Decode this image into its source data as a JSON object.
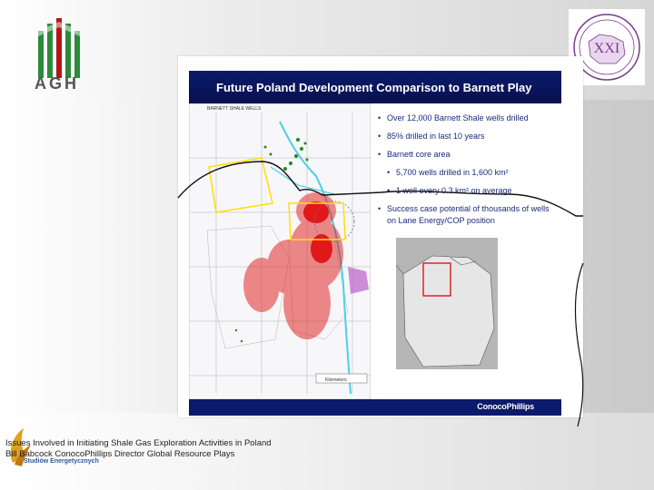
{
  "header": {
    "agh_logo_text": "AGH"
  },
  "seal": {
    "label": "XXI"
  },
  "slide": {
    "title": "Future Poland Development Comparison to Barnett Play",
    "map_header": "BARNETT SHALE WELLS",
    "map_scale_label": "Kilometers",
    "bullets": [
      "Over 12,000 Barnett Shale wells drilled",
      "85% drilled in last 10 years",
      "Barnett core area"
    ],
    "sub_bullets": [
      "5,700 wells drilled in 1,600 km²",
      "1 well every 0.3 km² on average"
    ],
    "bullet_success": "Success case potential of thousands of wells on Lane Energy/COP position",
    "brand": "ConocoPhillips"
  },
  "footer": {
    "line1": "Issues Involved in Initiating Shale Gas Exploration Activities in Poland",
    "line2": "Bill Babcock ConocoPhillips Director Global Resource Plays",
    "institute_name": "Studiów Energetycznych"
  },
  "colors": {
    "agh_green": "#2c8a3a",
    "agh_red": "#b01818",
    "navy": "#0c1a6b",
    "seal_purple": "#7a3c8a",
    "well_red": "#e01818",
    "well_green": "#1f8a1f",
    "outline_yellow": "#ffe000",
    "cyan_river": "#4ccfe8"
  }
}
